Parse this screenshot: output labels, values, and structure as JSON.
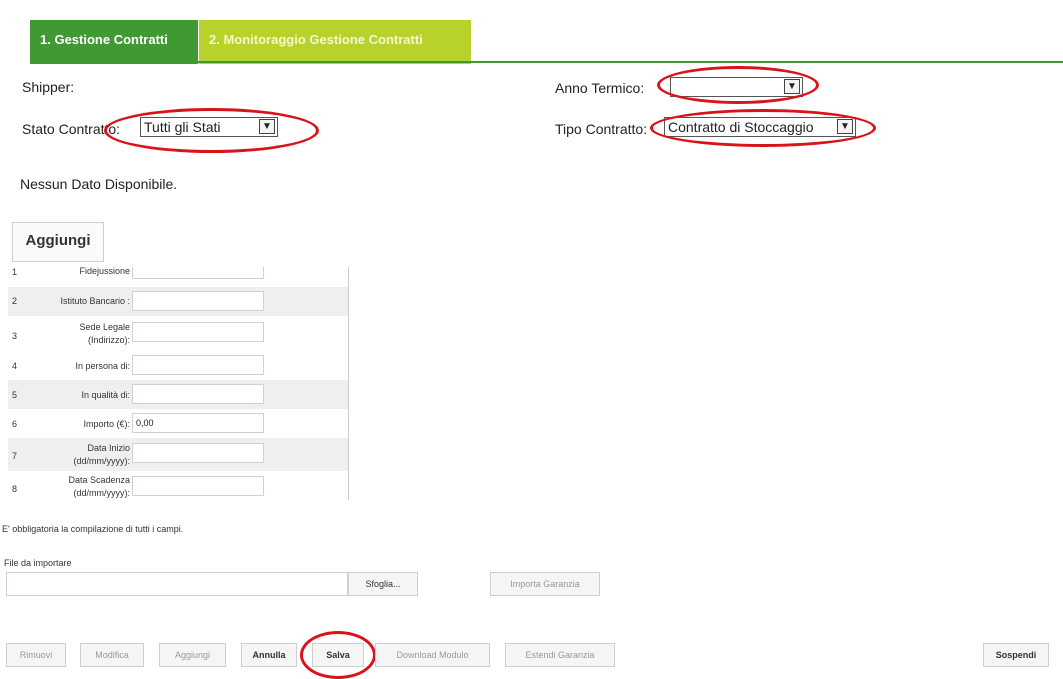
{
  "tabs": [
    {
      "label": "1. Gestione Contratti"
    },
    {
      "label": "2. Monitoraggio Gestione Contratti"
    }
  ],
  "filters": {
    "shipper_label": "Shipper:",
    "anno_termico_label": "Anno Termico:",
    "anno_termico_value": "",
    "stato_contratto_label": "Stato Contratto:",
    "stato_contratto_value": "Tutti gli Stati",
    "tipo_contratto_label": "Tipo Contratto:",
    "tipo_contratto_value": "Contratto di Stoccaggio"
  },
  "no_data_text": "Nessun Dato Disponibile.",
  "add_button_label": "Aggiungi",
  "form": {
    "rows": [
      {
        "num": "1",
        "label": "Fidejussione",
        "value": ""
      },
      {
        "num": "2",
        "label": "Istituto Bancario :",
        "value": ""
      },
      {
        "num": "3",
        "label": "Sede Legale (Indirizzo):",
        "value": ""
      },
      {
        "num": "4",
        "label": "In persona di:",
        "value": ""
      },
      {
        "num": "5",
        "label": "In qualità di:",
        "value": ""
      },
      {
        "num": "6",
        "label": "Importo (€):",
        "value": "0,00"
      },
      {
        "num": "7",
        "label": "Data Inizio (dd/mm/yyyy):",
        "value": ""
      },
      {
        "num": "8",
        "label": "Data Scadenza (dd/mm/yyyy):",
        "value": ""
      }
    ],
    "required_note": "E' obbligatoria la compilazione di tutti i campi."
  },
  "import": {
    "file_label": "File da importare",
    "browse_button": "Sfoglia...",
    "import_button": "Importa Garanzia"
  },
  "actions": {
    "rimuovi": "Rimuovi",
    "modifica": "Modifica",
    "aggiungi": "Aggiungi",
    "annulla": "Annulla",
    "salva": "Salva",
    "download_modulo": "Download Modulo",
    "estendi_garanzia": "Estendi Garanzia",
    "sospendi": "Sospendi"
  },
  "colors": {
    "tab_active": "#3f9a32",
    "tab_inactive": "#b9d22b",
    "highlight_oval": "#d8141b"
  }
}
